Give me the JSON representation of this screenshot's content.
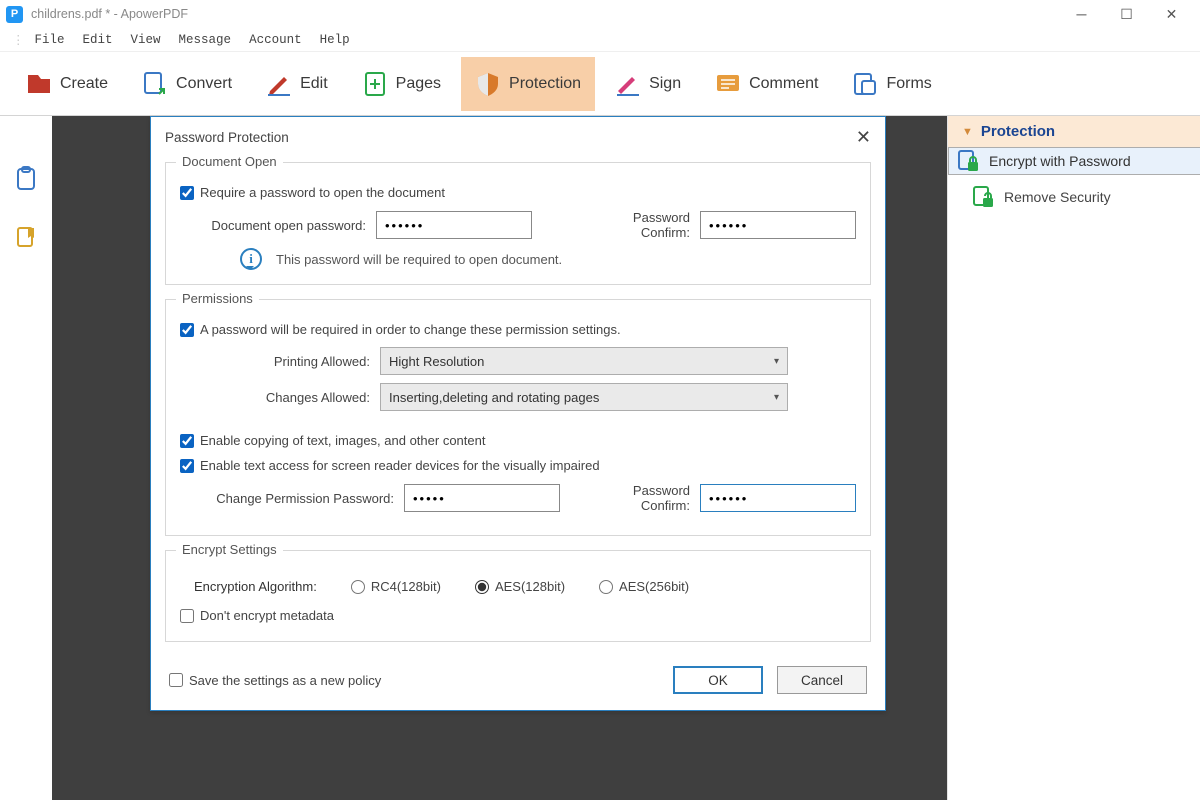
{
  "window": {
    "title": "childrens.pdf * - ApowerPDF",
    "app_icon_letter": "P"
  },
  "menu": {
    "file": "File",
    "edit": "Edit",
    "view": "View",
    "message": "Message",
    "account": "Account",
    "help": "Help"
  },
  "toolbar": {
    "create": "Create",
    "convert": "Convert",
    "edit": "Edit",
    "pages": "Pages",
    "protection": "Protection",
    "sign": "Sign",
    "comment": "Comment",
    "forms": "Forms"
  },
  "rightpanel": {
    "header": "Protection",
    "encrypt": "Encrypt with Password",
    "remove": "Remove Security"
  },
  "dialog": {
    "title": "Password Protection",
    "doc_open": {
      "legend": "Document Open",
      "require_label": "Require a password to open the document",
      "require_checked": true,
      "open_pw_label": "Document open password:",
      "open_pw_value": "••••••",
      "confirm_label": "Password Confirm:",
      "confirm_value": "••••••",
      "info": "This password will be required to open document."
    },
    "permissions": {
      "legend": "Permissions",
      "require_label": "A password will be required in order to change these permission settings.",
      "require_checked": true,
      "printing_label": "Printing Allowed:",
      "printing_value": "Hight Resolution",
      "changes_label": "Changes Allowed:",
      "changes_value": "Inserting,deleting and rotating pages",
      "enable_copy_label": "Enable copying of text, images, and other content",
      "enable_copy_checked": true,
      "enable_reader_label": "Enable text access for screen reader devices for the visually impaired",
      "enable_reader_checked": true,
      "perm_pw_label": "Change Permission Password:",
      "perm_pw_value": "•••••",
      "perm_confirm_label": "Password Confirm:",
      "perm_confirm_value": "••••••"
    },
    "encrypt": {
      "legend": "Encrypt Settings",
      "algo_label": "Encryption Algorithm:",
      "rc4": "RC4(128bit)",
      "aes128": "AES(128bit)",
      "aes256": "AES(256bit)",
      "selected": "aes128",
      "no_meta_label": "Don't encrypt metadata",
      "no_meta_checked": false
    },
    "save_policy_label": "Save the settings as a new policy",
    "save_policy_checked": false,
    "ok": "OK",
    "cancel": "Cancel"
  }
}
